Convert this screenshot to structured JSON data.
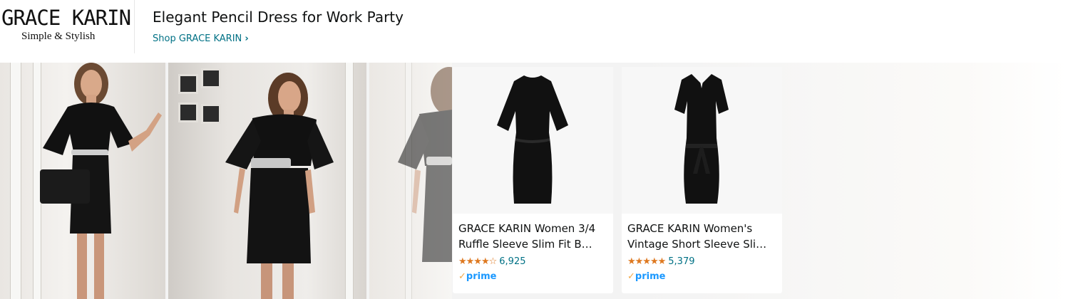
{
  "brand": {
    "name": "GRACE KARIN",
    "tagline": "Simple & Stylish"
  },
  "header": {
    "headline": "Elegant Pencil Dress for Work Party",
    "shop_link": "Shop GRACE KARIN",
    "shop_chevron": "›"
  },
  "banner_photos": [
    {
      "name": "model-photo-1",
      "alt_icon": "woman-black-dress-photo"
    },
    {
      "name": "model-photo-2",
      "alt_icon": "woman-black-dress-photo"
    },
    {
      "name": "model-photo-3",
      "alt_icon": "woman-black-dress-photo"
    }
  ],
  "products": [
    {
      "title_line1": "GRACE KARIN Women 3/4",
      "title_line2": "Ruffle Sleeve Slim Fit B…",
      "stars": "★★★★☆",
      "rating_value": 4.3,
      "review_count": "6,925",
      "prime_check": "✓",
      "prime_label": "prime"
    },
    {
      "title_line1": "GRACE KARIN Women's",
      "title_line2": "Vintage Short Sleeve Sli…",
      "stars": "★★★★★",
      "rating_value": 4.4,
      "review_count": "5,379",
      "prime_check": "✓",
      "prime_label": "prime"
    }
  ],
  "colors": {
    "link": "#007185",
    "star": "#de7921",
    "prime_blue": "#1a98ff",
    "prime_check": "#f3a847",
    "text": "#0f1111"
  }
}
